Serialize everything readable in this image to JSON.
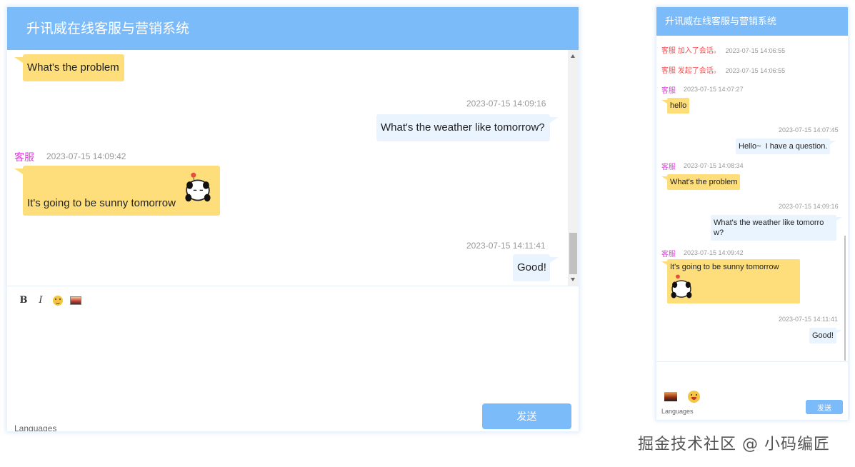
{
  "large": {
    "title": "升讯威在线客服与营销系统",
    "messages": [
      {
        "type": "agent",
        "text": "What's the problem"
      },
      {
        "type": "user",
        "time": "2023-07-15 14:09:16",
        "text": "What's the weather like tomorrow?"
      },
      {
        "type": "agent",
        "sender": "客服",
        "time": "2023-07-15 14:09:42",
        "text": "It's going to be sunny tomorrow"
      },
      {
        "type": "user",
        "time": "2023-07-15 14:11:41",
        "text": "Good!"
      }
    ],
    "toolbar": {
      "bold": "B",
      "italic": "I",
      "emoji_icon": "emoji-icon",
      "image_icon": "image-icon"
    },
    "send_label": "发送",
    "languages_label": "Languages"
  },
  "small": {
    "title": "升讯威在线客服与营销系统",
    "system": [
      {
        "who": "客服",
        "action": "加入了会话。",
        "time": "2023-07-15 14:06:55"
      },
      {
        "who": "客服",
        "action": "发起了会话。",
        "time": "2023-07-15 14:06:55"
      }
    ],
    "messages": [
      {
        "type": "agent",
        "sender": "客服",
        "time": "2023-07-15 14:07:27",
        "text": "hello"
      },
      {
        "type": "user",
        "time": "2023-07-15 14:07:45",
        "text": "Hello~  I have a question."
      },
      {
        "type": "agent",
        "sender": "客服",
        "time": "2023-07-15 14:08:34",
        "text": "What's the problem"
      },
      {
        "type": "user",
        "time": "2023-07-15 14:09:16",
        "text_line1": "What's the weather like tomorro",
        "text_line2": "w?"
      },
      {
        "type": "agent",
        "sender": "客服",
        "time": "2023-07-15 14:09:42",
        "text": "It's going to be sunny tomorrow"
      },
      {
        "type": "user",
        "time": "2023-07-15 14:11:41",
        "text": "Good!"
      }
    ],
    "send_label": "发送",
    "languages_label": "Languages"
  },
  "watermark": "掘金技术社区 @ 小码编匠",
  "colors": {
    "header": "#7cbbfa",
    "agent_bubble": "#fede7a",
    "user_bubble": "#eaf4ff",
    "sender": "#e040e0",
    "system": "#ff4d4f"
  }
}
